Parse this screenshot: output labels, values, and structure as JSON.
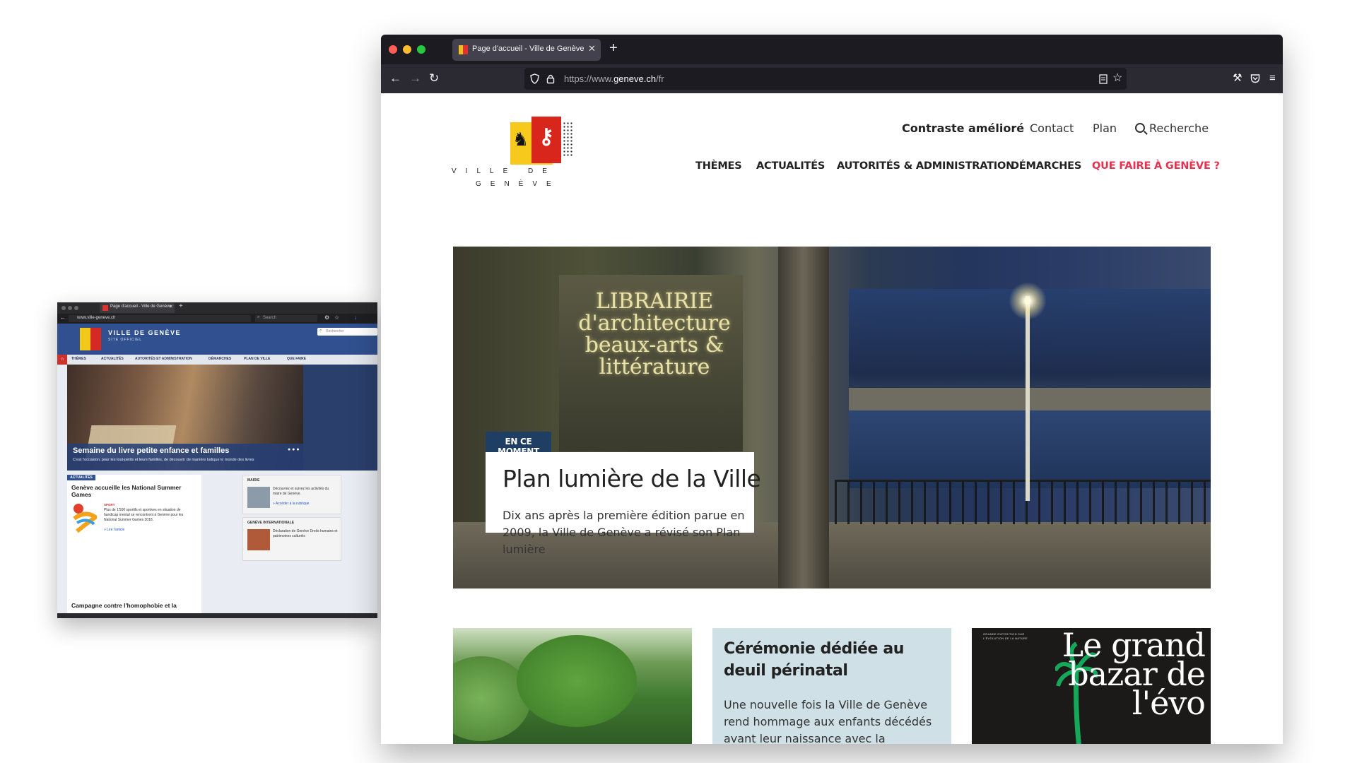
{
  "old_browser": {
    "tab_title": "Page d'accueil - Ville de Genève",
    "url": "www.ville-geneve.ch",
    "search_placeholder": "Search",
    "site_title": "VILLE DE GENÈVE",
    "site_subtitle": "SITE OFFICIEL",
    "header_search_placeholder": "Rechercher",
    "menu": [
      "THÈMES",
      "ACTUALITÉS",
      "AUTORITÉS ET ADMINISTRATION",
      "DÉMARCHES",
      "PLAN DE VILLE",
      "QUE FAIRE"
    ],
    "hero_title": "Semaine du livre petite enfance et familles",
    "hero_text": "C'est l'occasion, pour les tout-petits et leurs familles, de découvrir de manière ludique le monde des livres",
    "news_badge": "ACTUALITÉS",
    "news1_title": "Genève accueille les National Summer Games",
    "news1_tag": "SPORT",
    "news1_text": "Plus de 1'500 sportifs et sportives en situation de handicap mental se rencontrent à Genève pour les National Summer Games 2018.",
    "news1_link": "» Lire l'article",
    "news2_title": "Campagne contre l'homophobie et la",
    "card_mairie_label": "MAIRIE",
    "card_mairie_text": "Découvrez et suivez les activités du maire de Genève.",
    "card_mairie_link": "» Accéder à la rubrique",
    "card_gi_label": "GENÈVE INTERNATIONALE",
    "card_gi_text": "Déclaration de Genève Droits humains et patrimoines culturels"
  },
  "browser": {
    "tab_title": "Page d'accueil - Ville de Genève",
    "url_scheme": "https://www.",
    "url_host": "geneve.ch",
    "url_path": "/fr"
  },
  "site": {
    "logo_line1": "VILLE DE",
    "logo_line2": "GENÈVE",
    "top_links": {
      "contrast": "Contraste amélioré",
      "contact": "Contact",
      "plan": "Plan",
      "search": "Recherche"
    },
    "nav": {
      "themes": "THÈMES",
      "actualites": "ACTUALITÉS",
      "autorites": "AUTORITÉS & ADMINISTRATION",
      "demarches": "DÉMARCHES",
      "que_faire": "QUE FAIRE À GENÈVE ?"
    },
    "hero": {
      "badge": "EN CE MOMENT",
      "title": "Plan lumière de la Ville",
      "subtitle": "Dix ans après la première édition parue en 2009, la Ville de Genève a révisé son Plan lumière",
      "sign_text": "LIBRAIRIE d'architecture beaux-arts & littérature"
    },
    "cards": {
      "card2_title": "Cérémonie dédiée au deuil périnatal",
      "card2_text": "Une nouvelle fois la Ville de Genève rend hommage aux enfants décédés avant leur naissance avec la",
      "card3_big": "Le grand bazar de l'évo",
      "card3_small": "GRANDE EXPOSITION SUR L'ÉVOLUTION DE LA NATURE"
    }
  },
  "colors": {
    "accent_red": "#e5324f",
    "badge_navy": "#1f3e63",
    "old_header_blue": "#30508f",
    "card2_bg": "#cfe0e6"
  }
}
